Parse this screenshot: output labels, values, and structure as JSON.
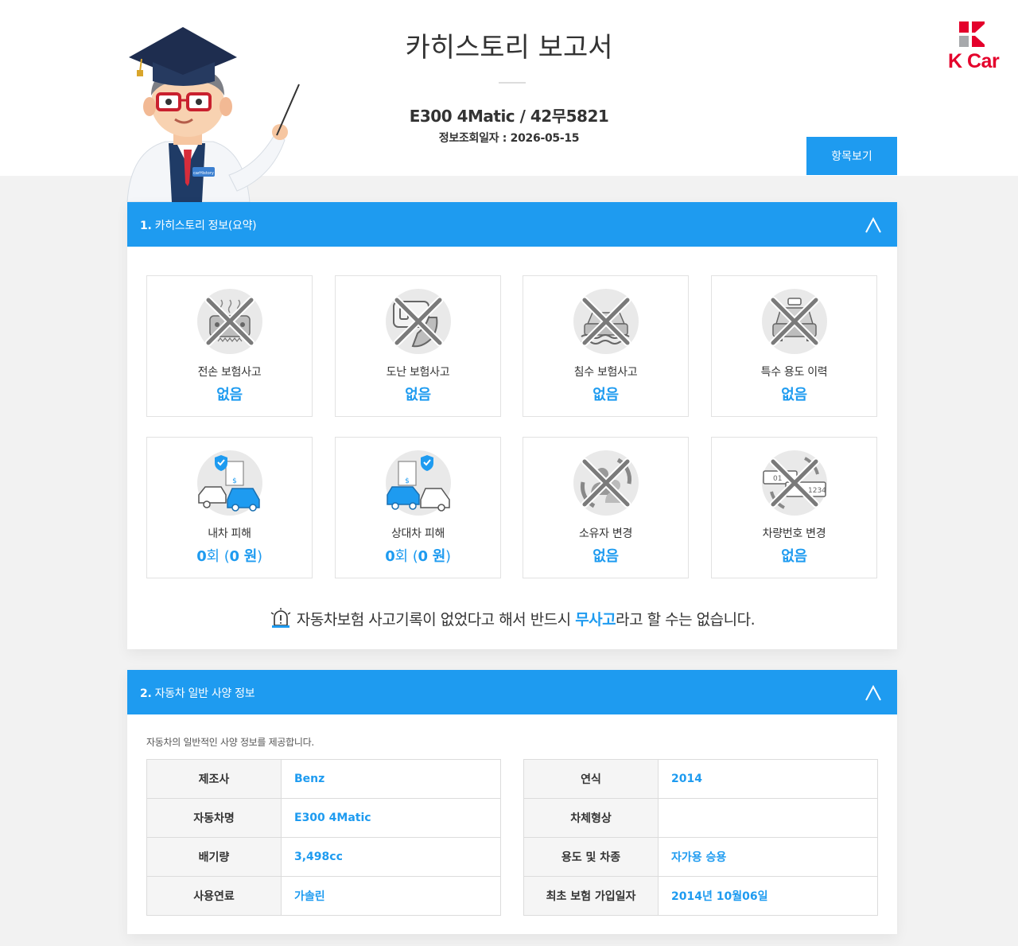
{
  "header": {
    "title": "카히스토리 보고서",
    "car_name": "E300 4Matic / 42무5821",
    "query_date": "정보조회일자 : 2026-05-15",
    "view_items_label": "항목보기",
    "logo_text": "K Car",
    "mascot_badge_text": "carHistory"
  },
  "colors": {
    "accent": "#1e9bf0",
    "brand": "#e4002b",
    "header_bar": "#1e9bf0"
  },
  "section1": {
    "number": "1.",
    "title": "카히스토리 정보(요약)",
    "toggle_icon": "chevron-up-icon",
    "cards": [
      {
        "label": "전손 보험사고",
        "value": "없음",
        "icon": "total-loss-icon"
      },
      {
        "label": "도난 보험사고",
        "value": "없음",
        "icon": "theft-icon"
      },
      {
        "label": "침수 보험사고",
        "value": "없음",
        "icon": "flood-icon"
      },
      {
        "label": "특수 용도 이력",
        "value": "없음",
        "icon": "special-use-icon"
      },
      {
        "label": "내차 피해",
        "value_count": "0",
        "value_count_unit": "회",
        "value_amount": "0 원",
        "icon": "own-damage-icon"
      },
      {
        "label": "상대차 피해",
        "value_count": "0",
        "value_count_unit": "회",
        "value_amount": "0 원",
        "icon": "other-damage-icon"
      },
      {
        "label": "소유자 변경",
        "value": "없음",
        "icon": "owner-change-icon"
      },
      {
        "label": "차량번호 변경",
        "value": "없음",
        "icon": "plate-change-icon"
      }
    ],
    "plate_icon_text": [
      "01",
      "1234"
    ],
    "notice": {
      "before": "자동차보험 사고기록이 없었다고 해서 반드시 ",
      "highlight": "무사고",
      "after": "라고 할 수는 없습니다.",
      "icon": "siren-icon"
    }
  },
  "section2": {
    "number": "2.",
    "title": "자동차 일반 사양 정보",
    "toggle_icon": "chevron-up-icon",
    "description": "자동차의 일반적인 사양 정보를 제공합니다.",
    "left_table": [
      {
        "key": "제조사",
        "value": "Benz"
      },
      {
        "key": "자동차명",
        "value": "E300 4Matic"
      },
      {
        "key": "배기량",
        "value": "3,498cc"
      },
      {
        "key": "사용연료",
        "value": "가솔린"
      }
    ],
    "right_table": [
      {
        "key": "연식",
        "value": "2014"
      },
      {
        "key": "차체형상",
        "value": ""
      },
      {
        "key": "용도 및 차종",
        "value": "자가용 승용"
      },
      {
        "key": "최초 보험 가입일자",
        "value": "2014년 10월06일"
      }
    ]
  }
}
